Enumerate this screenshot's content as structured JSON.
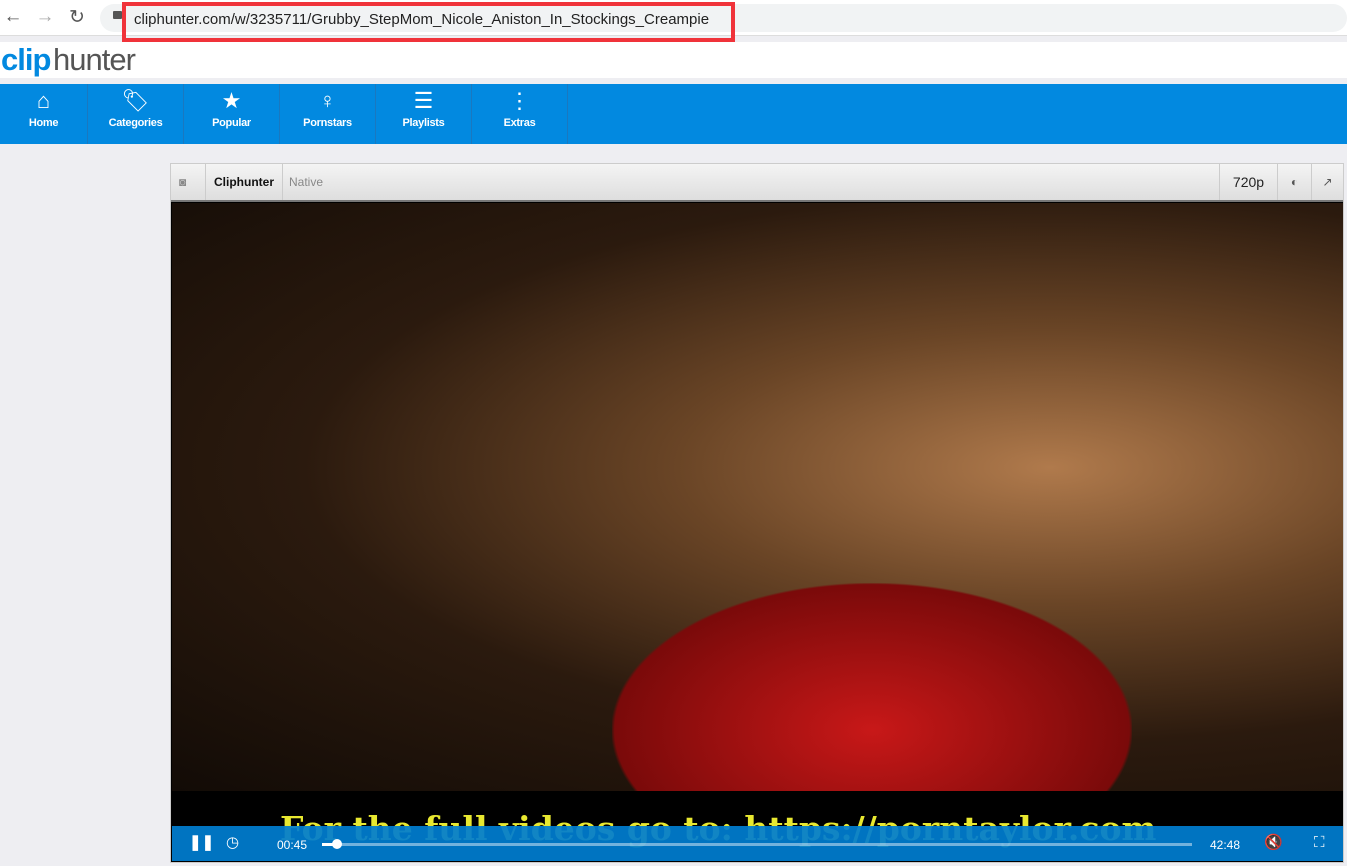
{
  "browser": {
    "url": "cliphunter.com/w/3235711/Grubby_StepMom_Nicole_Aniston_In_Stockings_Creampie",
    "highlight_color": "#f0333a"
  },
  "site": {
    "logo_clip": "clip",
    "logo_hunter": "hunter",
    "brand_color": "#0289e0"
  },
  "nav": [
    {
      "label": "Home",
      "icon": "home-icon"
    },
    {
      "label": "Categories",
      "icon": "tags-icon"
    },
    {
      "label": "Popular",
      "icon": "stars-icon"
    },
    {
      "label": "Pornstars",
      "icon": "silhouette-icon"
    },
    {
      "label": "Playlists",
      "icon": "list-icon"
    },
    {
      "label": "Extras",
      "icon": "dots-vertical-icon"
    }
  ],
  "player": {
    "source": "Cliphunter",
    "mode": "Native",
    "quality": "720p",
    "current_time": "00:45",
    "duration": "42:48",
    "progress_percent": 1.75,
    "muted": true,
    "playing": true,
    "overlay_text": "For the full videos go to: https://porntaylor.com"
  }
}
